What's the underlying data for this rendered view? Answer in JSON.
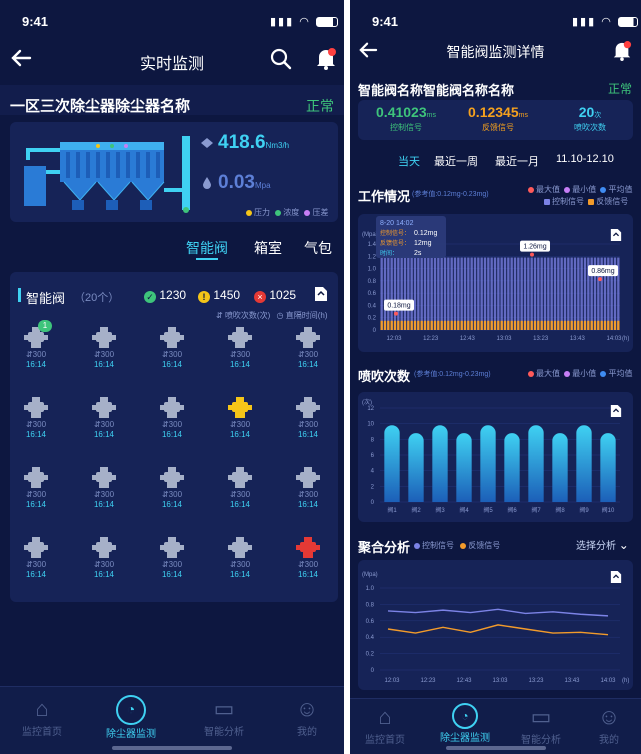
{
  "left": {
    "status": {
      "time": "9:41"
    },
    "nav": {
      "title": "实时监测"
    },
    "device": {
      "name": "一区三次除尘器除尘器名称",
      "status": "正常"
    },
    "flow": {
      "value": "418.6",
      "unit": "Nm3/h"
    },
    "pressure": {
      "value": "0.03",
      "unit": "Mpa"
    },
    "machine_legend": [
      "压力",
      "浓度",
      "压差"
    ],
    "segments": [
      "智能阀",
      "箱室",
      "气包"
    ],
    "valves_section": {
      "title": "智能阀",
      "count": "（20个）",
      "ok_count": "1230",
      "warn_count": "1450",
      "err_count": "1025",
      "legend_blow": "喷吹次数(次)",
      "legend_interval": "直隔时间(h)",
      "badge": "1"
    },
    "valve": {
      "count": "300",
      "time": "16:14"
    },
    "valve_states": [
      "badge",
      "normal",
      "normal",
      "normal",
      "normal",
      "normal",
      "normal",
      "normal",
      "warn",
      "normal",
      "normal",
      "normal",
      "normal",
      "normal",
      "normal",
      "normal",
      "normal",
      "normal",
      "normal",
      "error"
    ],
    "tabs": [
      "监控首页",
      "除尘器监测",
      "智能分析",
      "我的"
    ]
  },
  "right": {
    "status": {
      "time": "9:41"
    },
    "nav": {
      "title": "智能阀监测详情"
    },
    "valve": {
      "name": "智能阀名称智能阀名称名称",
      "status": "正常"
    },
    "metrics": [
      {
        "value": "0.41023",
        "unit": "ms",
        "label": "控制信号",
        "color": "#3ec47b"
      },
      {
        "value": "0.12345",
        "unit": "ms",
        "label": "反馈信号",
        "color": "#f5a11e"
      },
      {
        "value": "20",
        "unit": "次",
        "label": "喷吹次数",
        "color": "#3fd1f2"
      }
    ],
    "filters": [
      "当天",
      "最近一周",
      "最近一月",
      "11.10-12.10"
    ],
    "work": {
      "title": "工作情况",
      "ref": "(参考值:0.12mg-0.23mg)",
      "legend": [
        "最大值",
        "最小值",
        "平均值",
        "控制信号",
        "反馈信号"
      ],
      "ylabel": "(Mpa)",
      "tooltip": {
        "time": "8-20 14:02",
        "ctrl_label": "控制信号：",
        "ctrl_value": "0.12mg",
        "fb_label": "反馈信号：",
        "fb_value": "12mg",
        "t_label": "时间：",
        "t_value": "2s"
      },
      "annotations": [
        "0.18mg",
        "1.26mg",
        "0.86mg"
      ]
    },
    "blow": {
      "title": "喷吹次数",
      "ref": "(参考值:0.12mg-0.23mg)",
      "legend": [
        "最大值",
        "最小值",
        "平均值"
      ]
    },
    "agg": {
      "title": "聚合分析",
      "legend": [
        "控制信号",
        "反馈信号"
      ],
      "action": "选择分析"
    },
    "tabs": [
      "监控首页",
      "除尘器监测",
      "智能分析",
      "我的"
    ]
  },
  "chart_data": [
    {
      "type": "bar",
      "title": "工作情况",
      "ylabel": "(Mpa)",
      "xlabel": "(h)",
      "ylim": [
        0,
        1.4
      ],
      "yticks": [
        "1.4",
        "1.2",
        "1.0",
        "0.8",
        "0.6",
        "0.4",
        "0.2",
        "0"
      ],
      "categories": [
        "12:03",
        "12:23",
        "12:43",
        "13:03",
        "13:23",
        "13:43",
        "14:03"
      ],
      "series": [
        {
          "name": "控制信号",
          "values": [
            1.18,
            1.18,
            1.18,
            1.18,
            1.18,
            1.18,
            1.18
          ]
        },
        {
          "name": "反馈信号",
          "values": [
            0.15,
            0.15,
            0.15,
            0.15,
            0.15,
            0.15,
            0.15
          ]
        }
      ]
    },
    {
      "type": "bar",
      "title": "喷吹次数",
      "ylabel": "(次)",
      "ylim": [
        0,
        12
      ],
      "yticks": [
        "12",
        "10",
        "8",
        "6",
        "4",
        "2",
        "0"
      ],
      "categories": [
        "阀1",
        "阀2",
        "阀3",
        "阀4",
        "阀5",
        "阀6",
        "阀7",
        "阀8",
        "阀9",
        "阀10"
      ],
      "values": [
        9.8,
        8.8,
        9.8,
        8.8,
        9.8,
        8.8,
        9.8,
        8.8,
        9.8,
        8.8
      ]
    },
    {
      "type": "line",
      "title": "聚合分析",
      "ylabel": "(Mpa)",
      "xlabel": "(h)",
      "ylim": [
        0,
        1.0
      ],
      "yticks": [
        "1.0",
        "0.8",
        "0.6",
        "0.4",
        "0.2",
        "0"
      ],
      "x": [
        "12:03",
        "12:23",
        "12:43",
        "13:03",
        "13:23",
        "13:43",
        "14:03"
      ],
      "series": [
        {
          "name": "控制信号",
          "values": [
            0.72,
            0.7,
            0.73,
            0.7,
            0.74,
            0.69,
            0.71,
            0.68,
            0.66
          ]
        },
        {
          "name": "反馈信号",
          "values": [
            0.5,
            0.45,
            0.52,
            0.46,
            0.55,
            0.5,
            0.45,
            0.46,
            0.43
          ]
        }
      ]
    }
  ]
}
